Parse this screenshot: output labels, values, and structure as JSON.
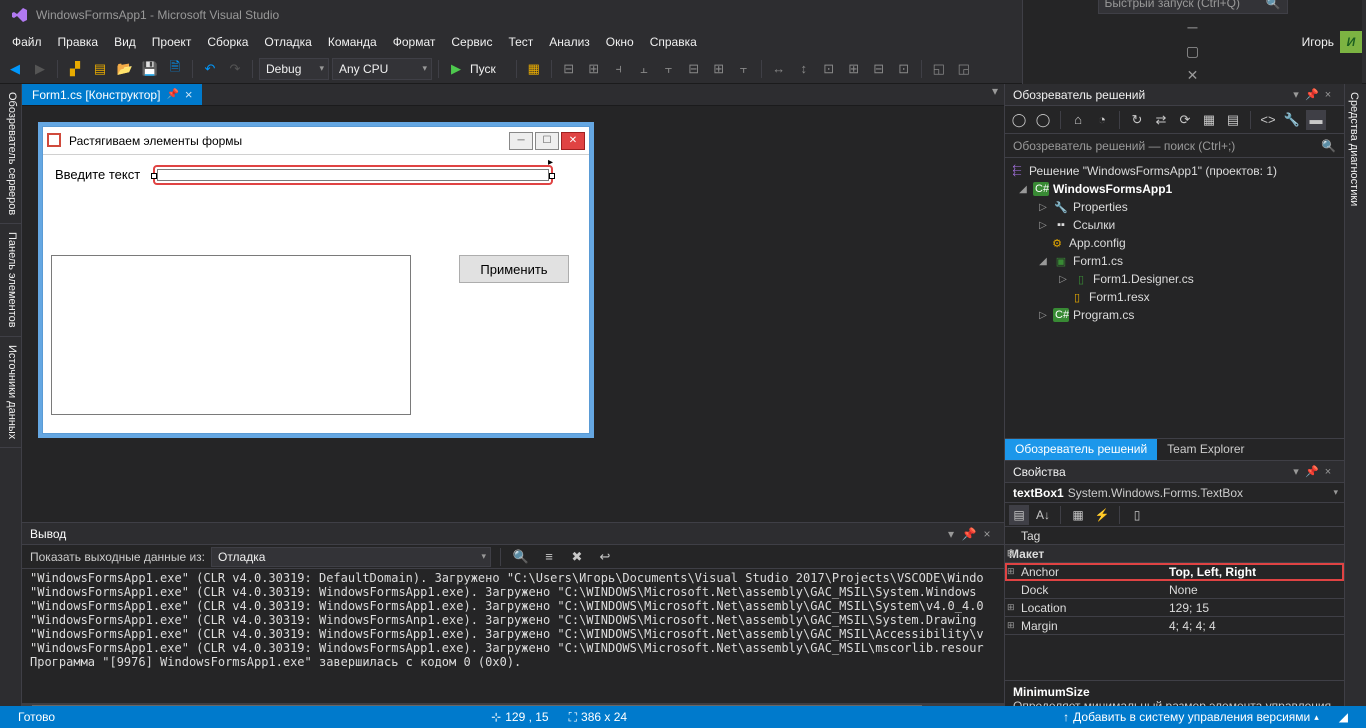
{
  "titlebar": {
    "title": "WindowsFormsApp1 - Microsoft Visual Studio",
    "search_placeholder": "Быстрый запуск (Ctrl+Q)"
  },
  "menu": [
    "Файл",
    "Правка",
    "Вид",
    "Проект",
    "Сборка",
    "Отладка",
    "Команда",
    "Формат",
    "Сервис",
    "Тест",
    "Анализ",
    "Окно",
    "Справка"
  ],
  "user": {
    "name": "Игорь",
    "initial": "И"
  },
  "toolbar": {
    "config": "Debug",
    "platform": "Any CPU",
    "run": "Пуск"
  },
  "tab": {
    "title": "Form1.cs [Конструктор]"
  },
  "left_tools": [
    "Обозреватель серверов",
    "Панель элементов",
    "Источники данных"
  ],
  "right_tool": "Средства диагностики",
  "winform": {
    "title": "Растягиваем элементы формы",
    "input_label": "Введите текст",
    "apply": "Применить"
  },
  "output": {
    "title": "Вывод",
    "from_label": "Показать выходные данные из:",
    "from_value": "Отладка",
    "lines": [
      "\"WindowsFormsApp1.exe\" (CLR v4.0.30319: DefaultDomain). Загружено \"C:\\Users\\Игорь\\Documents\\Visual Studio 2017\\Projects\\VSCODE\\Windo",
      "\"WindowsFormsApp1.exe\" (CLR v4.0.30319: WindowsFormsApp1.exe). Загружено \"C:\\WINDOWS\\Microsoft.Net\\assembly\\GAC_MSIL\\System.Windows",
      "\"WindowsFormsApp1.exe\" (CLR v4.0.30319: WindowsFormsApp1.exe). Загружено \"C:\\WINDOWS\\Microsoft.Net\\assembly\\GAC_MSIL\\System\\v4.0_4.0",
      "\"WindowsFormsApp1.exe\" (CLR v4.0.30319: WindowsFormsAnp1.exe). Загружено \"C:\\WINDOWS\\Microsoft.Net\\assembly\\GAC_MSIL\\System.Drawing",
      "\"WindowsFormsApp1.exe\" (CLR v4.0.30319: WindowsFormsApp1.exe). Загружено \"C:\\WINDOWS\\Microsoft.Net\\assembly\\GAC_MSIL\\Accessibility\\v",
      "\"WindowsFormsApp1.exe\" (CLR v4.0.30319: WindowsFormsApp1.exe). Загружено \"C:\\WINDOWS\\Microsoft.Net\\assembly\\GAC_MSIL\\mscorlib.resour",
      "Программа \"[9976] WindowsFormsApp1.exe\" завершилась с кодом 0 (0x0)."
    ]
  },
  "solution": {
    "panel_title": "Обозреватель решений",
    "search_placeholder": "Обозреватель решений — поиск (Ctrl+;)",
    "root": "Решение \"WindowsFormsApp1\" (проектов: 1)",
    "project": "WindowsFormsApp1",
    "nodes": {
      "properties": "Properties",
      "references": "Ссылки",
      "appconfig": "App.config",
      "form1": "Form1.cs",
      "form1designer": "Form1.Designer.cs",
      "form1resx": "Form1.resx",
      "program": "Program.cs"
    },
    "tabs": [
      "Обозреватель решений",
      "Team Explorer"
    ]
  },
  "props_panel": {
    "title": "Свойства",
    "selected": {
      "name": "textBox1",
      "type": "System.Windows.Forms.TextBox"
    },
    "rows": [
      {
        "kind": "prop",
        "key": "Tag",
        "value": ""
      },
      {
        "kind": "cat",
        "key": "Макет"
      },
      {
        "kind": "prop",
        "key": "Anchor",
        "value": "Top, Left, Right",
        "highlight": true,
        "exp": "⊞"
      },
      {
        "kind": "prop",
        "key": "Dock",
        "value": "None"
      },
      {
        "kind": "prop",
        "key": "Location",
        "value": "129; 15",
        "exp": "⊞"
      },
      {
        "kind": "prop",
        "key": "Margin",
        "value": "4; 4; 4; 4",
        "exp": "⊞"
      }
    ],
    "desc": {
      "name": "MinimumSize",
      "text": "Определяет минимальный размер элемента управления."
    }
  },
  "status": {
    "ready": "Готово",
    "pos": "129 , 15",
    "size": "386 x 24",
    "publish": "Добавить в систему управления версиями"
  }
}
